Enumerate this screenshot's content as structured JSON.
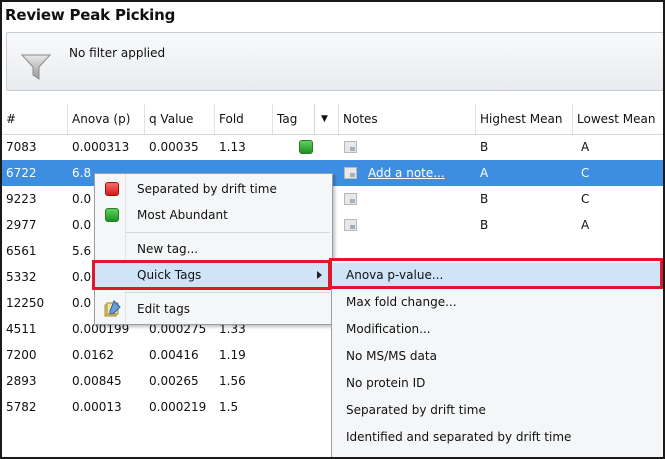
{
  "window": {
    "title": "Review Peak Picking"
  },
  "filter": {
    "icon": "funnel-icon",
    "text": "No filter applied"
  },
  "table": {
    "headers": [
      "#",
      "Anova (p)",
      "q Value",
      "Fold",
      "Tag",
      "Notes",
      "Highest Mean",
      "Lowest Mean"
    ],
    "rows": [
      {
        "id": "7083",
        "anova": "0.000313",
        "q": "0.00035",
        "fold": "1.13",
        "tag": "green",
        "note": "",
        "high": "B",
        "low": "A"
      },
      {
        "id": "6722",
        "anova": "6.8",
        "q": "",
        "fold": "",
        "tag": "",
        "note": "Add a note...",
        "high": "A",
        "low": "C"
      },
      {
        "id": "9223",
        "anova": "0.0",
        "q": "",
        "fold": "",
        "tag": "",
        "note": "",
        "high": "B",
        "low": "C"
      },
      {
        "id": "2977",
        "anova": "0.0",
        "q": "",
        "fold": "",
        "tag": "",
        "note": "",
        "high": "B",
        "low": "A"
      },
      {
        "id": "6561",
        "anova": "5.6",
        "q": "",
        "fold": "",
        "tag": "",
        "note": "",
        "high": "",
        "low": ""
      },
      {
        "id": "5332",
        "anova": "0.0",
        "q": "",
        "fold": "",
        "tag": "",
        "note": "",
        "high": "",
        "low": ""
      },
      {
        "id": "12250",
        "anova": "0.0",
        "q": "",
        "fold": "",
        "tag": "",
        "note": "",
        "high": "",
        "low": ""
      },
      {
        "id": "4511",
        "anova": "0.000199",
        "q": "0.000275",
        "fold": "1.33",
        "tag": "",
        "note": "",
        "high": "",
        "low": ""
      },
      {
        "id": "7200",
        "anova": "0.0162",
        "q": "0.00416",
        "fold": "1.19",
        "tag": "",
        "note": "",
        "high": "",
        "low": ""
      },
      {
        "id": "2893",
        "anova": "0.00845",
        "q": "0.00265",
        "fold": "1.56",
        "tag": "",
        "note": "",
        "high": "",
        "low": ""
      },
      {
        "id": "5782",
        "anova": "0.00013",
        "q": "0.000219",
        "fold": "1.5",
        "tag": "",
        "note": "",
        "high": "",
        "low": ""
      }
    ]
  },
  "context_menu": {
    "items": [
      {
        "label": "Separated by drift time",
        "icon": "red-tag-icon"
      },
      {
        "label": "Most Abundant",
        "icon": "green-tag-icon"
      },
      {
        "label": "New tag..."
      },
      {
        "label": "Quick Tags",
        "submenu": true
      },
      {
        "label": "Edit tags",
        "icon": "edit-tags-icon"
      }
    ]
  },
  "submenu": {
    "items": [
      "Anova p-value...",
      "Max fold change...",
      "Modification...",
      "No MS/MS data",
      "No protein ID",
      "Separated by drift time",
      "Identified and separated by drift time"
    ]
  },
  "colors": {
    "selection": "#3d8ee0",
    "highlight": "#cfe4f7",
    "callout": "#e0162b"
  }
}
